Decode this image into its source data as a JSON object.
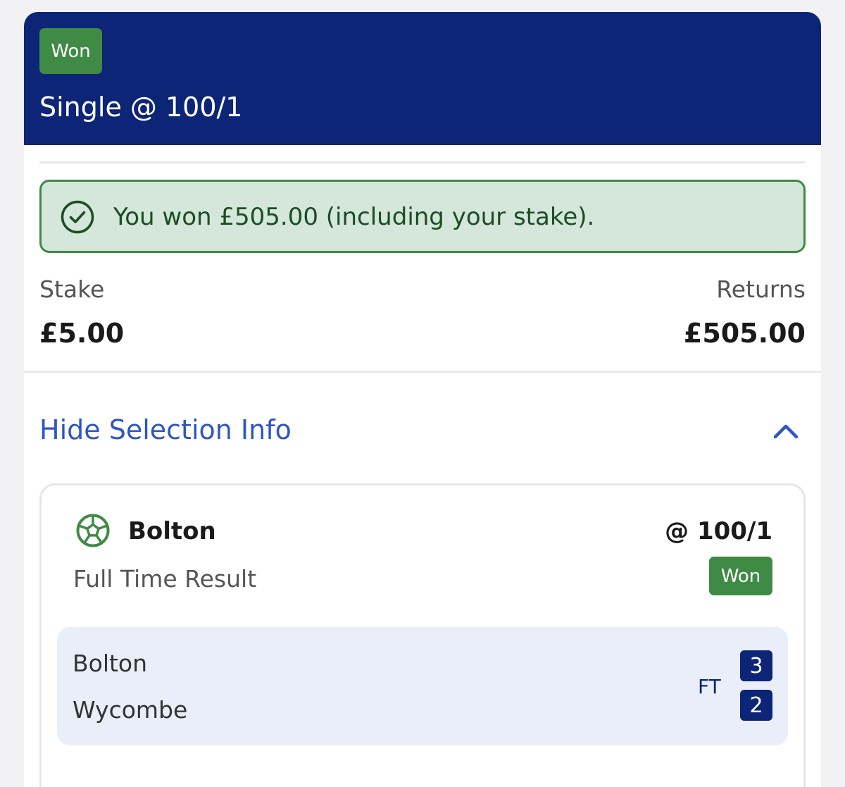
{
  "header": {
    "status_badge": "Won",
    "bet_title": "Single @ 100/1"
  },
  "result_banner": {
    "icon": "check-circle-icon",
    "message": "You won £505.00 (including your stake)."
  },
  "summary": {
    "stake_label": "Stake",
    "stake_value": "£5.00",
    "returns_label": "Returns",
    "returns_value": "£505.00"
  },
  "selection_toggle": {
    "label": "Hide Selection Info",
    "icon": "chevron-up-icon"
  },
  "selection": {
    "sport_icon": "football-icon",
    "name": "Bolton",
    "odds": "@ 100/1",
    "market": "Full Time Result",
    "status_badge": "Won",
    "match": {
      "home_team": "Bolton",
      "away_team": "Wycombe",
      "status": "FT",
      "home_score": "3",
      "away_score": "2"
    }
  },
  "colors": {
    "header_bg": "#0c2577",
    "won_green": "#3f8a45",
    "banner_bg": "#d4e7da",
    "link_blue": "#2f56c4",
    "score_panel_bg": "#e9eef9"
  }
}
